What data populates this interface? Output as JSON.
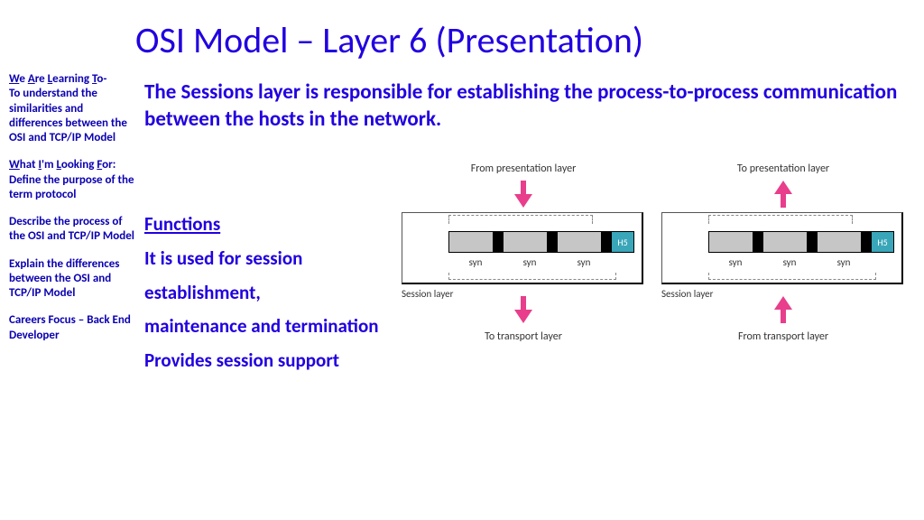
{
  "title": "OSI Model – Layer 6 (Presentation)",
  "sidebar": {
    "walt_heading_html": "<span class='u'>W</span>e <span class='u'>A</span>re <span class='u'>L</span>earning <span class='u'>T</span>o-",
    "walt_body": "To understand the similarities and differences between the OSI and TCP/IP Model",
    "wilf_heading_html": "<span class='u'>W</span>hat <span class='u'>I</span>'m <span class='u'>L</span>ooking <span class='u'>F</span>or:",
    "wilf1": "Define the purpose of the term protocol",
    "wilf2": "Describe the process of the OSI and TCP/IP Model",
    "wilf3": "Explain the differences between the OSI and TCP/IP Model",
    "careers": "Careers Focus – Back End Developer"
  },
  "intro": "The Sessions layer is responsible for establishing the process-to-process communication between the hosts in the network.",
  "functions_heading": "Functions",
  "functions_line1": "It is used for session",
  "functions_line2": "establishment,",
  "functions_line3": "maintenance and termination",
  "functions_line4": "Provides session support",
  "diagram": {
    "left": {
      "top": "From presentation layer",
      "bottom": "To transport layer",
      "side": "Session layer",
      "h5": "H5",
      "syn": "syn"
    },
    "right": {
      "top": "To presentation layer",
      "bottom": "From transport layer",
      "side": "Session layer",
      "h5": "H5",
      "syn": "syn"
    }
  },
  "colors": {
    "text_blue": "#2000e0",
    "arrow_pink": "#e83e8c",
    "h5_teal": "#3aa6b9"
  }
}
